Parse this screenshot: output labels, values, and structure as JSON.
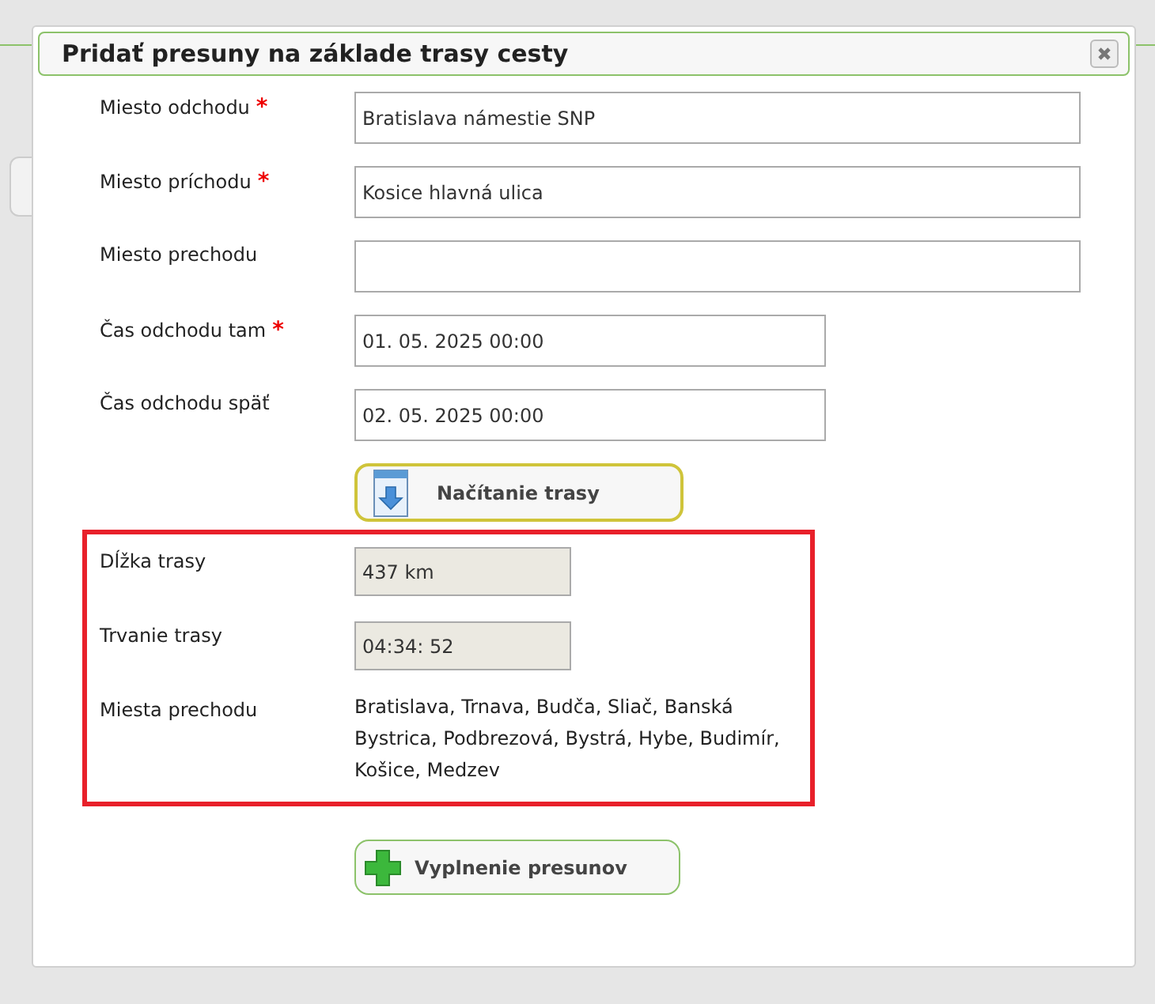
{
  "dialog": {
    "title": "Pridať presuny na základe trasy cesty",
    "fields": [
      {
        "label": "Miesto odchodu",
        "required_mark": "*",
        "kind": "text",
        "value": "Bratislava námestie SNP"
      },
      {
        "label": "Miesto príchodu",
        "required_mark": "*",
        "kind": "text",
        "value": "Kosice hlavná ulica"
      },
      {
        "label": "Miesto prechodu",
        "kind": "text"
      },
      {
        "label": "Čas odchodu tam",
        "required_mark": "*",
        "kind": "datetime",
        "value": "01. 05. 2025 00:00"
      },
      {
        "label": "Čas odchodu späť",
        "kind": "datetime",
        "value": "02. 05. 2025 00:00"
      }
    ],
    "load_button": {
      "label": "Načítanie trasy"
    },
    "route_summary": {
      "rows": [
        {
          "label": "Dĺžka trasy",
          "kind": "readonly",
          "value": "437 km"
        },
        {
          "label": "Trvanie trasy",
          "kind": "readonly",
          "value": "04:34: 52"
        },
        {
          "label": "Miesta prechodu",
          "kind": "text",
          "value": "Bratislava, Trnava, Budča, Sliač, Banská Bystrica, Podbrezová, Bystrá, Hybe, Budimír, Košice, Medzev"
        }
      ]
    },
    "fill_button": {
      "label": "Vyplnenie presunov"
    }
  }
}
